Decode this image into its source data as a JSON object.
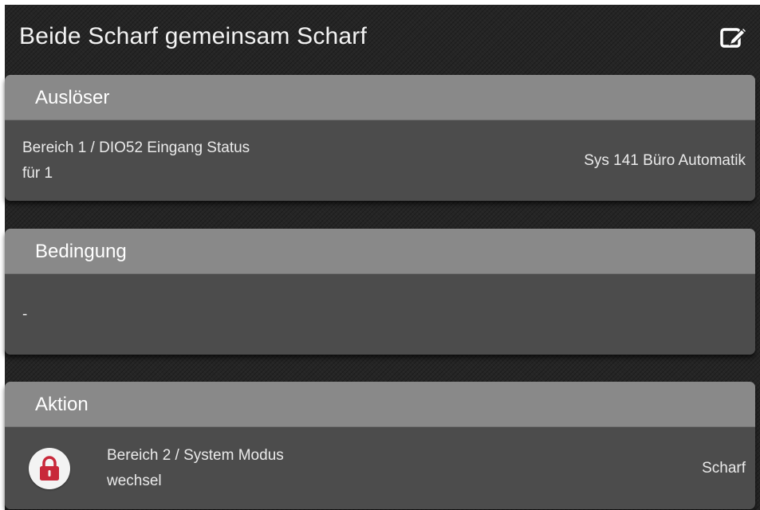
{
  "header": {
    "title": "Beide Scharf gemeinsam Scharf",
    "edit_icon": "edit-icon"
  },
  "trigger": {
    "header": "Auslöser",
    "line1": "Bereich 1 / DIO52 Eingang Status",
    "line2": "für 1",
    "value": "Sys 141 Büro Automatik"
  },
  "condition": {
    "header": "Bedingung",
    "value": "-"
  },
  "action": {
    "header": "Aktion",
    "icon": "lock-icon",
    "line1": "Bereich 2 / System Modus",
    "line2": "wechsel",
    "value": "Scharf"
  },
  "colors": {
    "background": "#252525",
    "card_header": "#898989",
    "card_body": "#4c4c4c",
    "lock_red": "#c8283a"
  }
}
